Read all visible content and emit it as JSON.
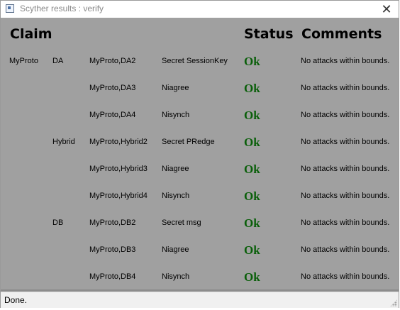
{
  "window": {
    "title": "Scyther results : verify",
    "close_glyph": "✕"
  },
  "headers": {
    "claim": "Claim",
    "status": "Status",
    "comments": "Comments"
  },
  "rows": [
    {
      "protocol": "MyProto",
      "role": "DA",
      "claim_id": "MyProto,DA2",
      "claim_type": "Secret SessionKey",
      "status": "Ok",
      "comment": "No attacks within bounds."
    },
    {
      "protocol": "",
      "role": "",
      "claim_id": "MyProto,DA3",
      "claim_type": "Niagree",
      "status": "Ok",
      "comment": "No attacks within bounds."
    },
    {
      "protocol": "",
      "role": "",
      "claim_id": "MyProto,DA4",
      "claim_type": "Nisynch",
      "status": "Ok",
      "comment": "No attacks within bounds."
    },
    {
      "protocol": "",
      "role": "Hybrid",
      "claim_id": "MyProto,Hybrid2",
      "claim_type": "Secret PRedge",
      "status": "Ok",
      "comment": "No attacks within bounds."
    },
    {
      "protocol": "",
      "role": "",
      "claim_id": "MyProto,Hybrid3",
      "claim_type": "Niagree",
      "status": "Ok",
      "comment": "No attacks within bounds."
    },
    {
      "protocol": "",
      "role": "",
      "claim_id": "MyProto,Hybrid4",
      "claim_type": "Nisynch",
      "status": "Ok",
      "comment": "No attacks within bounds."
    },
    {
      "protocol": "",
      "role": "DB",
      "claim_id": "MyProto,DB2",
      "claim_type": "Secret msg",
      "status": "Ok",
      "comment": "No attacks within bounds."
    },
    {
      "protocol": "",
      "role": "",
      "claim_id": "MyProto,DB3",
      "claim_type": "Niagree",
      "status": "Ok",
      "comment": "No attacks within bounds."
    },
    {
      "protocol": "",
      "role": "",
      "claim_id": "MyProto,DB4",
      "claim_type": "Nisynch",
      "status": "Ok",
      "comment": "No attacks within bounds."
    }
  ],
  "statusbar": {
    "text": "Done."
  },
  "colors": {
    "content_bg": "#a0a0a0",
    "ok_green": "#0a5f0a"
  },
  "icons": {
    "app": "scyther-app-icon",
    "close": "close-icon",
    "grip": "resize-grip-icon"
  }
}
